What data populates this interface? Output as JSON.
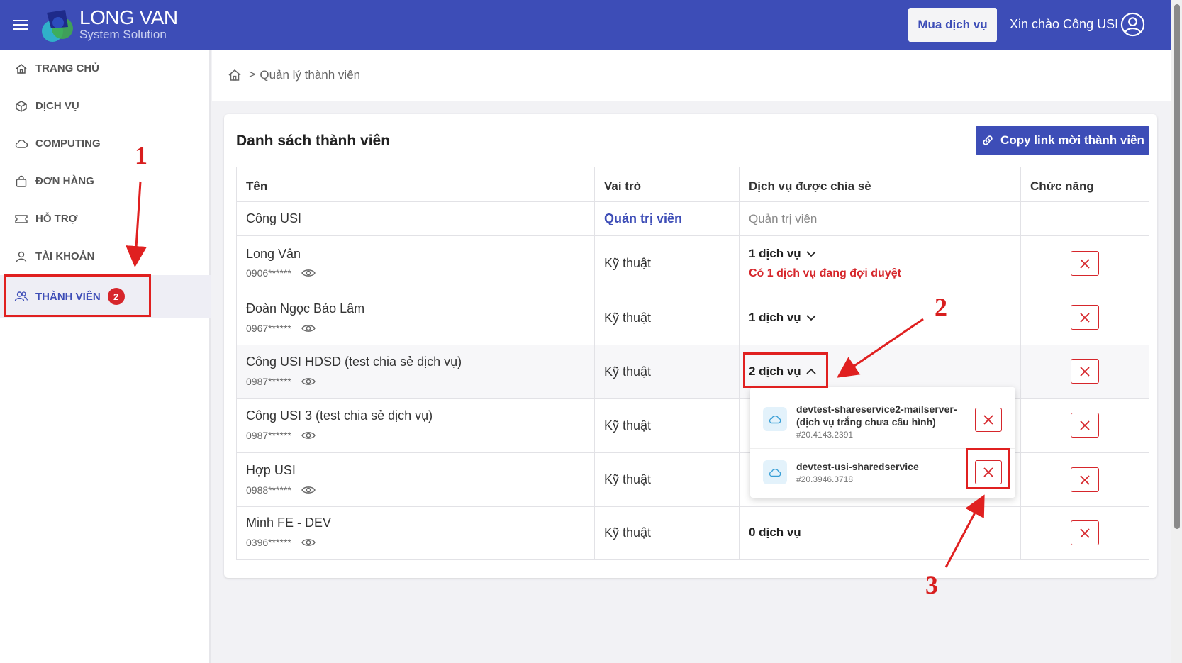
{
  "header": {
    "brand_name": "LONG VAN",
    "brand_sub": "System Solution",
    "buy_label": "Mua dịch vụ",
    "greeting": "Xin chào Công USI",
    "color": "#3d4db7"
  },
  "sidebar": {
    "items": [
      {
        "label": "TRANG CHỦ",
        "icon": "home-icon"
      },
      {
        "label": "DỊCH VỤ",
        "icon": "box-icon"
      },
      {
        "label": "COMPUTING",
        "icon": "cloud-icon"
      },
      {
        "label": "ĐƠN HÀNG",
        "icon": "bag-icon"
      },
      {
        "label": "HỖ TRỢ",
        "icon": "ticket-icon"
      },
      {
        "label": "TÀI KHOẢN",
        "icon": "user-icon"
      },
      {
        "label": "THÀNH VIÊN",
        "icon": "users-icon",
        "badge": "2",
        "active": true
      }
    ]
  },
  "breadcrumb": {
    "separator": ">",
    "current": "Quản lý thành viên"
  },
  "card": {
    "title": "Danh sách thành viên",
    "copy_label": "Copy link mời thành viên"
  },
  "table": {
    "headers": [
      "Tên",
      "Vai trò",
      "Dịch vụ được chia sẻ",
      "Chức năng"
    ],
    "rows": [
      {
        "name": "Công USI",
        "role": "Quản trị viên",
        "services": "Quản trị viên"
      },
      {
        "name": "Long Vân",
        "phone": "0906******",
        "role": "Kỹ thuật",
        "services": "1 dịch vụ",
        "pending": "Có 1 dịch vụ đang đợi duyệt"
      },
      {
        "name": "Đoàn Ngọc Bảo Lâm",
        "phone": "0967******",
        "role": "Kỹ thuật",
        "services": "1 dịch vụ"
      },
      {
        "name": "Công USI HDSD (test chia sẻ dịch vụ)",
        "phone": "0987******",
        "role": "Kỹ thuật",
        "services": "2 dịch vụ",
        "expanded": true
      },
      {
        "name": "Công USI 3 (test chia sẻ dịch vụ)",
        "phone": "0987******",
        "role": "Kỹ thuật"
      },
      {
        "name": "Hợp USI",
        "phone": "0988******",
        "role": "Kỹ thuật"
      },
      {
        "name": "Minh FE - DEV",
        "phone": "0396******",
        "role": "Kỹ thuật",
        "services": "0 dịch vụ"
      }
    ]
  },
  "popup": {
    "items": [
      {
        "name": "devtest-shareservice2-mailserver-(dịch vụ trắng chưa cấu hình)",
        "code": "#20.4143.2391"
      },
      {
        "name": "devtest-usi-sharedservice",
        "code": "#20.3946.3718"
      }
    ]
  },
  "annotations": {
    "step1": "1",
    "step2": "2",
    "step3": "3",
    "color": "#e02020"
  }
}
